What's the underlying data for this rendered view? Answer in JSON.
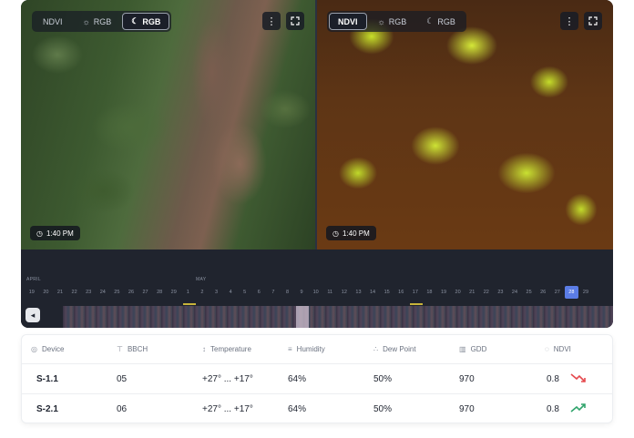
{
  "viewer": {
    "left_pane": {
      "options": [
        {
          "label": "NDVI",
          "icon": "",
          "active": false
        },
        {
          "label": "RGB",
          "icon": "sun-icon",
          "active": false
        },
        {
          "label": "RGB",
          "icon": "moon-icon",
          "active": true
        }
      ],
      "time": "1:40 PM"
    },
    "right_pane": {
      "options": [
        {
          "label": "NDVI",
          "icon": "",
          "active": true
        },
        {
          "label": "RGB",
          "icon": "sun-icon",
          "active": false
        },
        {
          "label": "RGB",
          "icon": "moon-icon",
          "active": false
        }
      ],
      "time": "1:40 PM"
    }
  },
  "timeline": {
    "months": [
      "APRIL",
      "MAY"
    ],
    "days": [
      "19",
      "20",
      "21",
      "22",
      "23",
      "24",
      "25",
      "26",
      "27",
      "28",
      "29",
      "1",
      "2",
      "3",
      "4",
      "5",
      "6",
      "7",
      "8",
      "9",
      "10",
      "11",
      "12",
      "13",
      "14",
      "15",
      "16",
      "17",
      "18",
      "19",
      "20",
      "21",
      "22",
      "23",
      "24",
      "25",
      "26",
      "27",
      "28",
      "29"
    ],
    "selected_day": "8",
    "today": "28",
    "accent_colors": {
      "selected": "#7bc043",
      "today": "#5b7de6",
      "marker": "#c8b43a"
    }
  },
  "table": {
    "headers": [
      {
        "label": "Device",
        "icon": "device-icon"
      },
      {
        "label": "BBCH",
        "icon": "plant-icon"
      },
      {
        "label": "Temperature",
        "icon": "thermometer-icon"
      },
      {
        "label": "Humidity",
        "icon": "humidity-icon"
      },
      {
        "label": "Dew Point",
        "icon": "dew-point-icon"
      },
      {
        "label": "GDD",
        "icon": "chart-icon"
      },
      {
        "label": "NDVI",
        "icon": "ndvi-icon"
      }
    ],
    "rows": [
      {
        "device": "S-1.1",
        "bbch": "05",
        "temperature": "+27° ... +17°",
        "humidity": "64%",
        "dew_point": "50%",
        "gdd": "970",
        "ndvi": "0.8",
        "trend": "down",
        "trend_color": "#e5484d"
      },
      {
        "device": "S-2.1",
        "bbch": "06",
        "temperature": "+27° ... +17°",
        "humidity": "64%",
        "dew_point": "50%",
        "gdd": "970",
        "ndvi": "0.8",
        "trend": "up",
        "trend_color": "#30a46c"
      }
    ]
  }
}
